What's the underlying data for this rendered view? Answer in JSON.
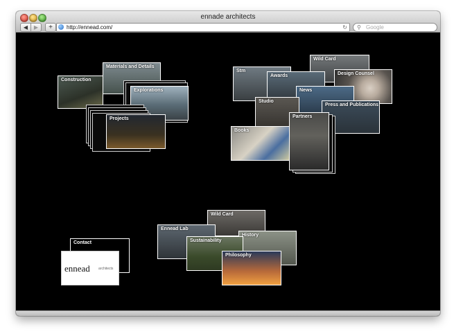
{
  "window": {
    "title": "ennade architects"
  },
  "toolbar": {
    "back_glyph": "◀",
    "forward_glyph": "▶",
    "add_glyph": "+",
    "url": "http://ennead.com/",
    "reload_glyph": "↻",
    "search_placeholder": "Google",
    "search_glyph": "⚲"
  },
  "nav_cards": {
    "construction": "Construction",
    "materials_and_details": "Materials and Details",
    "explorations": "Explorations",
    "projects": "Projects",
    "stm": "Stm",
    "awards": "Awards",
    "wild_card_top": "Wild Card",
    "design_counsel": "Design Counsel",
    "news": "News",
    "studio": "Studio",
    "press_and_publications": "Press and Publications",
    "books": "Books",
    "partners": "Partners",
    "contact": "Contact",
    "wild_card_bottom": "Wild Card",
    "ennead_lab": "Ennead Lab",
    "history": "History",
    "sustainability": "Sustainability",
    "philosophy": "Philosophy"
  },
  "logo": {
    "main": "ennead",
    "sub": "architects"
  }
}
